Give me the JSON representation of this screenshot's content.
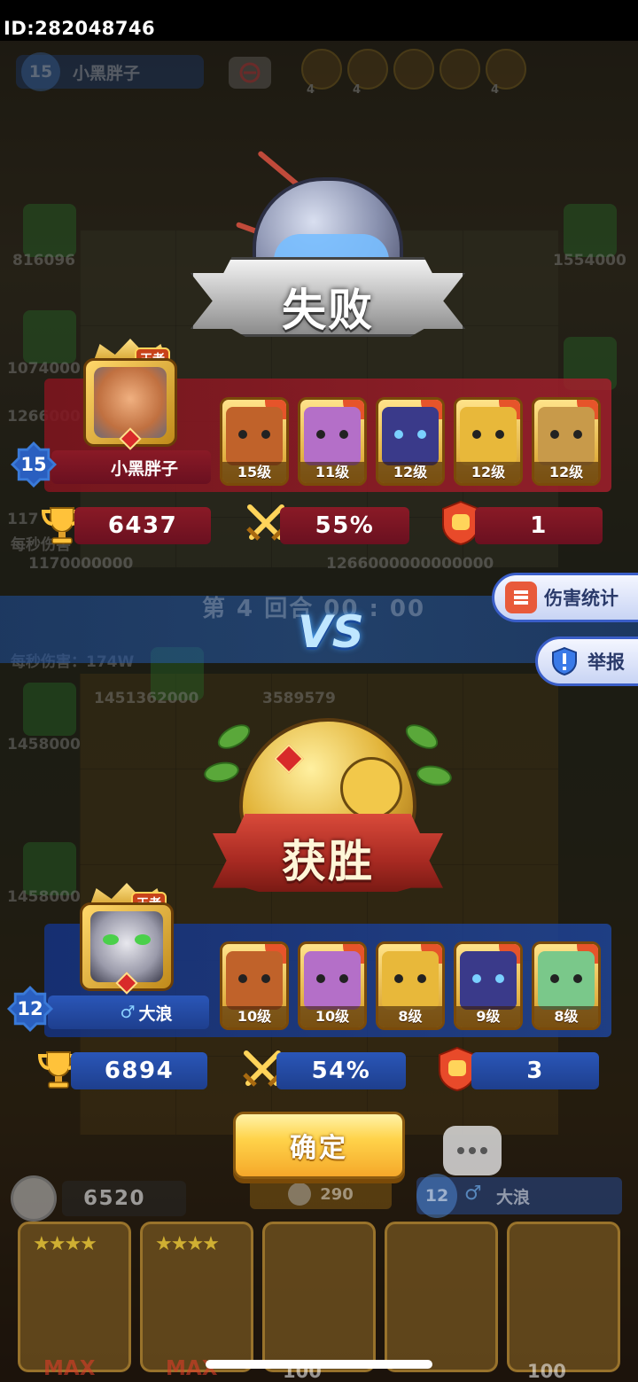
{
  "status_bar": {
    "id_text": "ID:282048746"
  },
  "top_bar": {
    "player_level": "15",
    "player_name": "小黑胖子",
    "hero_stars": [
      "4",
      "4",
      "4"
    ]
  },
  "background": {
    "numbers": [
      "816096",
      "1554000",
      "1074000",
      "1266000",
      "117",
      "每秒伤害",
      "1170000000",
      "1266000000000000",
      "每秒伤害：174W",
      "1451362000",
      "3589579",
      "1458000",
      "1458000"
    ]
  },
  "lose_result": {
    "label": "失败"
  },
  "win_result": {
    "label": "获胜"
  },
  "loser": {
    "crown_tag": "王者",
    "level": "15",
    "name": "小黑胖子",
    "heroes": [
      {
        "level": "15级",
        "color": "#c0622a"
      },
      {
        "level": "11级",
        "color": "#b46fc8"
      },
      {
        "level": "12级",
        "color": "#3a3a8a"
      },
      {
        "level": "12级",
        "color": "#e8b83a"
      },
      {
        "level": "12级",
        "color": "#c89a4a"
      }
    ],
    "trophies": "6437",
    "win_rate": "55%",
    "fist_count": "1"
  },
  "round_text": "第 4 回合 00 : 00",
  "vs_label": "VS",
  "side_buttons": {
    "damage_stats": "伤害统计",
    "report": "举报"
  },
  "winner": {
    "crown_tag": "王者",
    "level": "12",
    "gender_symbol": "♂",
    "name": "大浪",
    "heroes": [
      {
        "level": "10级",
        "color": "#c0622a"
      },
      {
        "level": "10级",
        "color": "#b46fc8"
      },
      {
        "level": "8级",
        "color": "#e8b83a"
      },
      {
        "level": "9级",
        "color": "#3a3a8a"
      },
      {
        "level": "8级",
        "color": "#7ac88a"
      }
    ],
    "trophies": "6894",
    "win_rate": "54%",
    "fist_count": "3"
  },
  "confirm_button": {
    "label": "确定"
  },
  "bottom": {
    "coins": "6520",
    "mid_value": "290",
    "opponent_level": "12",
    "opponent_gender": "♂",
    "opponent_name": "大浪",
    "deck": [
      {
        "badge": "MAX"
      },
      {
        "badge": "MAX"
      },
      {
        "badge": "100"
      },
      {
        "badge": ""
      },
      {
        "badge": "100"
      }
    ]
  },
  "colors": {
    "loser_panel": "#a81e2d",
    "winner_panel": "#1e46a0",
    "gold": "#ffd34a"
  }
}
